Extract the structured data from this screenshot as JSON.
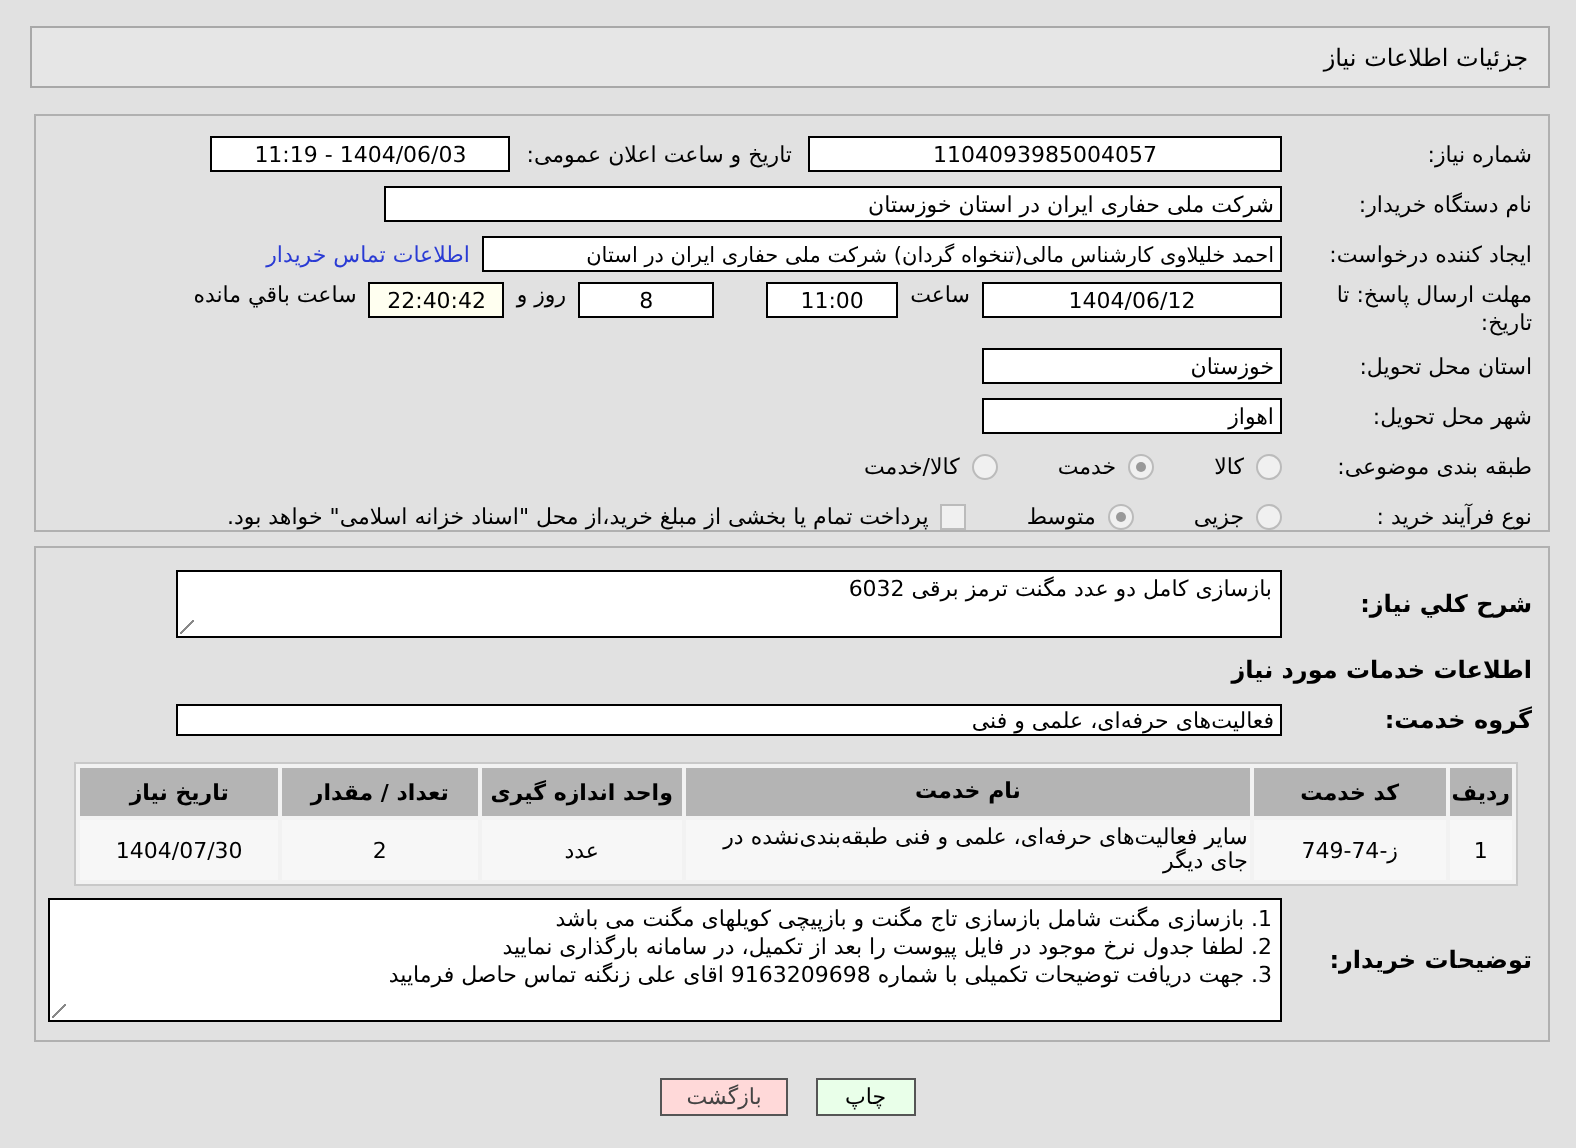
{
  "page_title": "جزئیات اطلاعات نیاز",
  "need_number": {
    "label": "شماره نیاز:",
    "value": "1104093985004057"
  },
  "announce": {
    "label": "تاریخ و ساعت اعلان عمومی:",
    "value": "1404/06/03 - 11:19"
  },
  "buyer_org": {
    "label": "نام دستگاه خریدار:",
    "value": "شرکت ملی حفاری ایران در استان خوزستان"
  },
  "creator": {
    "label": "ایجاد کننده درخواست:",
    "value": "احمد خلیلاوی کارشناس مالی(تنخواه گردان) شرکت ملی حفاری ایران در استان",
    "link": "اطلاعات تماس خریدار"
  },
  "deadline": {
    "label": "مهلت ارسال پاسخ: تا تاریخ:",
    "date": "1404/06/12",
    "time_label": "ساعت",
    "time": "11:00",
    "days": "8",
    "days_label": "روز و",
    "remaining": "22:40:42",
    "remaining_label": "ساعت باقي مانده"
  },
  "province": {
    "label": "استان محل تحویل:",
    "value": "خوزستان"
  },
  "city": {
    "label": "شهر محل تحویل:",
    "value": "اهواز"
  },
  "category": {
    "label": "طبقه بندی موضوعی:",
    "options": [
      {
        "label": "کالا",
        "selected": false
      },
      {
        "label": "خدمت",
        "selected": true
      },
      {
        "label": "کالا/خدمت",
        "selected": false
      }
    ]
  },
  "process": {
    "label": "نوع فرآیند خرید :",
    "options": [
      {
        "label": "جزیی",
        "selected": false
      },
      {
        "label": "متوسط",
        "selected": true
      }
    ],
    "payment": {
      "checked": false,
      "label": "پرداخت تمام یا بخشی از مبلغ خرید،از محل \"اسناد خزانه اسلامی\" خواهد بود."
    }
  },
  "summary": {
    "label": "شرح کلي نياز:",
    "value": "بازسازی کامل دو عدد مگنت ترمز برقی 6032"
  },
  "services_heading": "اطلاعات خدمات مورد نیاز",
  "service_group": {
    "label": "گروه خدمت:",
    "value": "فعالیت‌های حرفه‌ای، علمی و فنی"
  },
  "table": {
    "columns": [
      "ردیف",
      "کد خدمت",
      "نام خدمت",
      "واحد اندازه گیری",
      "تعداد / مقدار",
      "تاریخ نیاز"
    ],
    "rows": [
      [
        "1",
        "ز-74-749",
        "سایر فعالیت‌های حرفه‌ای، علمی و فنی طبقه‌بندی‌نشده در جای دیگر",
        "عدد",
        "2",
        "1404/07/30"
      ]
    ]
  },
  "buyer_notes": {
    "label": "توضیحات خریدار:",
    "lines": [
      "1. بازسازی مگنت شامل بازسازی تاج مگنت و بازپیچی کویلهای مگنت می باشد",
      "2. لطفا جدول نرخ موجود در فایل پیوست را بعد از تکمیل، در سامانه بارگذاری نمایید",
      "3. جهت دریافت توضیحات تکمیلی با شماره 9163209698 اقای علی زنگنه تماس حاصل فرمایید"
    ]
  },
  "buttons": [
    {
      "kind": "print",
      "label": "چاپ"
    },
    {
      "kind": "back",
      "label": "بازگشت"
    }
  ]
}
